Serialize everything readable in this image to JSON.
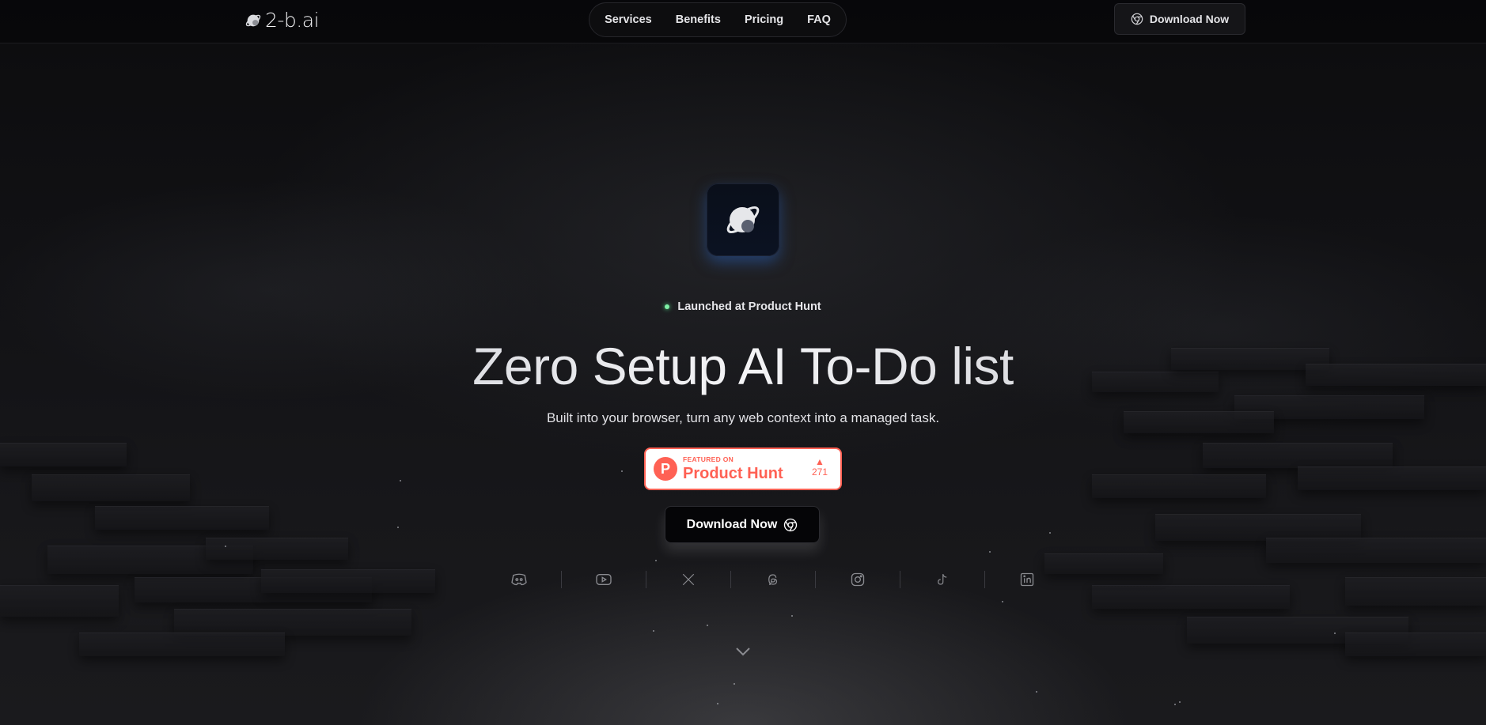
{
  "header": {
    "logo_text": "2-b.ai",
    "nav": [
      {
        "label": "Services"
      },
      {
        "label": "Benefits"
      },
      {
        "label": "Pricing"
      },
      {
        "label": "FAQ"
      }
    ],
    "download_label": "Download Now"
  },
  "hero": {
    "launch_badge": "Launched at Product Hunt",
    "headline": "Zero Setup AI To-Do list",
    "subtitle": "Built into your browser, turn any web context into a managed task.",
    "product_hunt": {
      "small": "FEATURED ON",
      "big": "Product Hunt",
      "votes": "271",
      "logo_letter": "P"
    },
    "download_label": "Download Now"
  },
  "socials": [
    "discord-icon",
    "youtube-icon",
    "x-icon",
    "threads-icon",
    "instagram-icon",
    "tiktok-icon",
    "linkedin-icon"
  ],
  "colors": {
    "accent": "#ff6154",
    "status_dot": "#7ef0a6",
    "background": "#0b0b0d"
  }
}
